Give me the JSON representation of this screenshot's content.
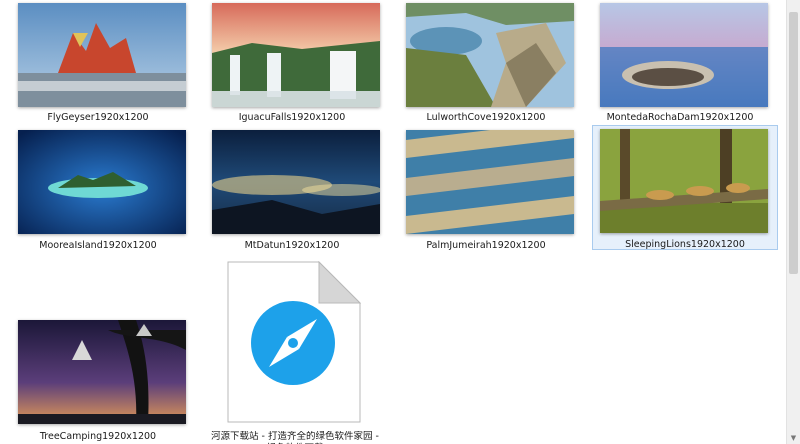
{
  "files": [
    {
      "name": "FlyGeyser1920x1200"
    },
    {
      "name": "IguacuFalls1920x1200"
    },
    {
      "name": "LulworthCove1920x1200"
    },
    {
      "name": "MontedaRochaDam1920x1200"
    },
    {
      "name": "MooreaIsland1920x1200"
    },
    {
      "name": "MtDatun1920x1200"
    },
    {
      "name": "PalmJumeirah1920x1200"
    },
    {
      "name": "SleepingLions1920x1200",
      "selected": true
    },
    {
      "name": "TreeCamping1920x1200"
    },
    {
      "name": "河源下载站 - 打造齐全的绿色软件家园 - 绿色软件下载"
    }
  ],
  "icons": {
    "doc_icon": "compass-document-icon",
    "scroll_down": "chevron-down-icon"
  },
  "colors": {
    "selection_bg": "#e6f0fb",
    "selection_border": "#a9cbee",
    "doc_icon_blue": "#1da1ea"
  }
}
